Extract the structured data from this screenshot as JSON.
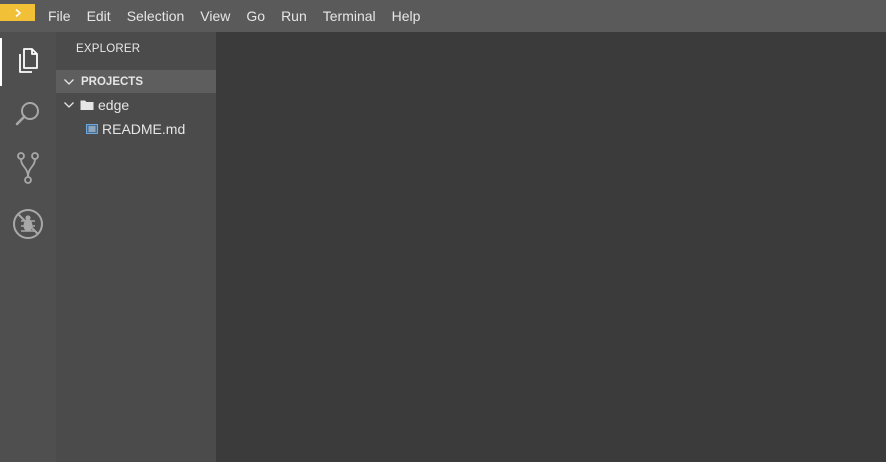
{
  "menubar": {
    "items": [
      {
        "id": "file",
        "label": "File"
      },
      {
        "id": "edit",
        "label": "Edit"
      },
      {
        "id": "selection",
        "label": "Selection"
      },
      {
        "id": "view",
        "label": "View"
      },
      {
        "id": "go",
        "label": "Go"
      },
      {
        "id": "run",
        "label": "Run"
      },
      {
        "id": "terminal",
        "label": "Terminal"
      },
      {
        "id": "help",
        "label": "Help"
      }
    ],
    "logo_color": "#f2c037"
  },
  "activitybar": {
    "icons": [
      {
        "name": "explorer-icon",
        "active": true
      },
      {
        "name": "search-icon",
        "active": false
      },
      {
        "name": "source-control-icon",
        "active": false
      },
      {
        "name": "debug-icon",
        "active": false
      }
    ]
  },
  "sidebar": {
    "title": "EXPLORER",
    "section": {
      "label": "PROJECTS",
      "expanded": true
    },
    "tree": {
      "folder": {
        "label": "edge",
        "expanded": true,
        "icon": "folder-icon"
      },
      "file": {
        "label": "README.md",
        "icon": "markdown-file-icon",
        "icon_color": "#6fa8dc"
      }
    }
  }
}
